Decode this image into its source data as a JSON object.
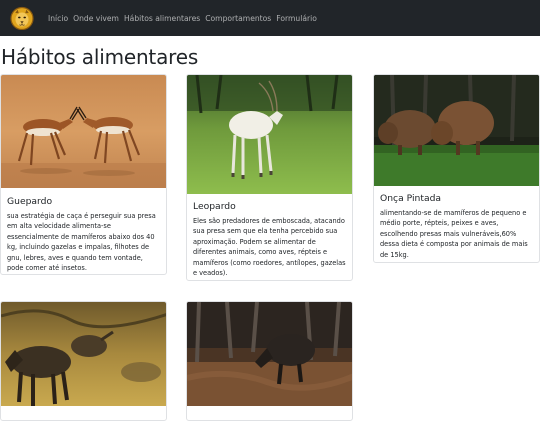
{
  "navbar": {
    "logo_icon": "big-cat-face-icon",
    "links": [
      "Início",
      "Onde vivem",
      "Hábitos alimentares",
      "Comportamentos",
      "Formulário"
    ]
  },
  "page": {
    "title": "Hábitos alimentares"
  },
  "cards": [
    {
      "title": "Guepardo",
      "image": "two-gazelles-sparring-photo",
      "text": "sua estratégia de caça é perseguir sua presa em alta velocidade alimenta-se essencialmente de mamíferos abaixo dos 40 kg, incluindo gazelas e impalas, filhotes de gnu, lebres, aves e quando tem vontade, pode comer até insetos."
    },
    {
      "title": "Leopardo",
      "image": "white-antelope-in-grass-photo",
      "text": "Eles são predadores de emboscada, atacando sua presa sem que ela tenha percebido sua aproximação. Podem se alimentar de diferentes animais, como aves, répteis e mamíferos (como roedores, antílopes, gazelas e veados)."
    },
    {
      "title": "Onça Pintada",
      "image": "capybaras-grazing-photo",
      "text": "alimentando-se de mamíferos de pequeno e médio porte, répteis, peixes e aves, escolhendo presas mais vulneráveis,60% dessa dieta é composta por animais de mais de 15kg."
    },
    {
      "title": "",
      "image": "wildebeest-herd-photo",
      "text": ""
    },
    {
      "title": "",
      "image": "wild-boar-in-forest-photo",
      "text": ""
    }
  ]
}
